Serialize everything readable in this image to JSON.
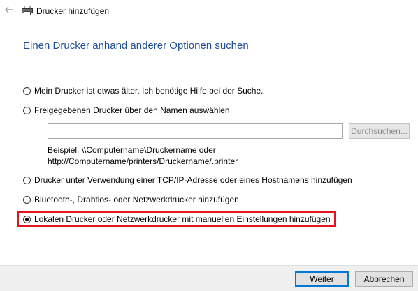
{
  "window": {
    "title": "Drucker hinzufügen",
    "back_icon": "back-arrow-icon",
    "title_icon": "printer-icon"
  },
  "heading": "Einen Drucker anhand anderer Optionen suchen",
  "options": [
    {
      "label": "Mein Drucker ist etwas älter. Ich benötige Hilfe bei der Suche.",
      "checked": false
    },
    {
      "label": "Freigegebenen Drucker über den Namen auswählen",
      "checked": false
    },
    {
      "label": "Drucker unter Verwendung einer TCP/IP-Adresse oder eines Hostnamens hinzufügen",
      "checked": false
    },
    {
      "label": "Bluetooth-, Drahtlos- oder Netzwerkdrucker hinzufügen",
      "checked": false
    },
    {
      "label": "Lokalen Drucker oder Netzwerkdrucker mit manuellen Einstellungen hinzufügen",
      "checked": true
    }
  ],
  "share": {
    "value": "",
    "browse_label": "Durchsuchen...",
    "example_line1": "Beispiel: \\\\Computername\\Druckername oder",
    "example_line2": "http://Computername/printers/Druckername/.printer"
  },
  "footer": {
    "next_label": "Weiter",
    "cancel_label": "Abbrechen"
  },
  "colors": {
    "heading": "#1f4e9d",
    "highlight": "#e3161f",
    "footer_bg": "#f0f0f0",
    "primary_border": "#0078d7"
  }
}
